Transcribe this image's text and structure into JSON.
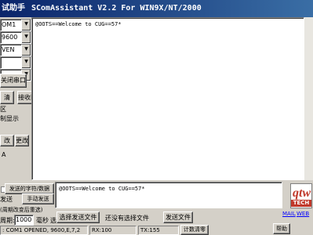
{
  "window": {
    "title_cn": "试助手",
    "title_en": "SComAssistant V2.2 For WIN9X/NT/2000"
  },
  "settings": {
    "port": "OM1",
    "baud": "9600",
    "parity": "VEN",
    "databits": "",
    "stopbits": ""
  },
  "left_panel": {
    "close_port_label": "关闭串口",
    "clear_label": "清",
    "receive_area_label": "接收区",
    "label_qu": "区",
    "hex_display_label": "制显示",
    "change_label": "改",
    "change_label2": "更改",
    "letter_a": "A"
  },
  "receive": {
    "text": "@OOTS==Welcome to CUG==57*"
  },
  "send": {
    "text": "@OOTS==Welcome to CUG==57*",
    "send_chars_label": "发送的字符/数据",
    "manual_send_label": "手动发送",
    "auto_send_label": "发送",
    "auto_hint": "(周期改变后重选)",
    "period_prefix": "周期:",
    "period_value": "1000",
    "period_unit": "毫秒",
    "select_file_label": "选择发送文件",
    "no_file_label": "还没有选择文件",
    "send_file_label": "发送文件",
    "prefix_label": "选"
  },
  "links": {
    "mail": "MAIL",
    "web": "WEB"
  },
  "logo": {
    "text": "TECH"
  },
  "status": {
    "port_info": ": COM1 OPENED, 9600,E,7,2",
    "rx": "RX:100",
    "tx": "TX:155",
    "reset_label": "计数清零",
    "help_label": "帮助"
  }
}
